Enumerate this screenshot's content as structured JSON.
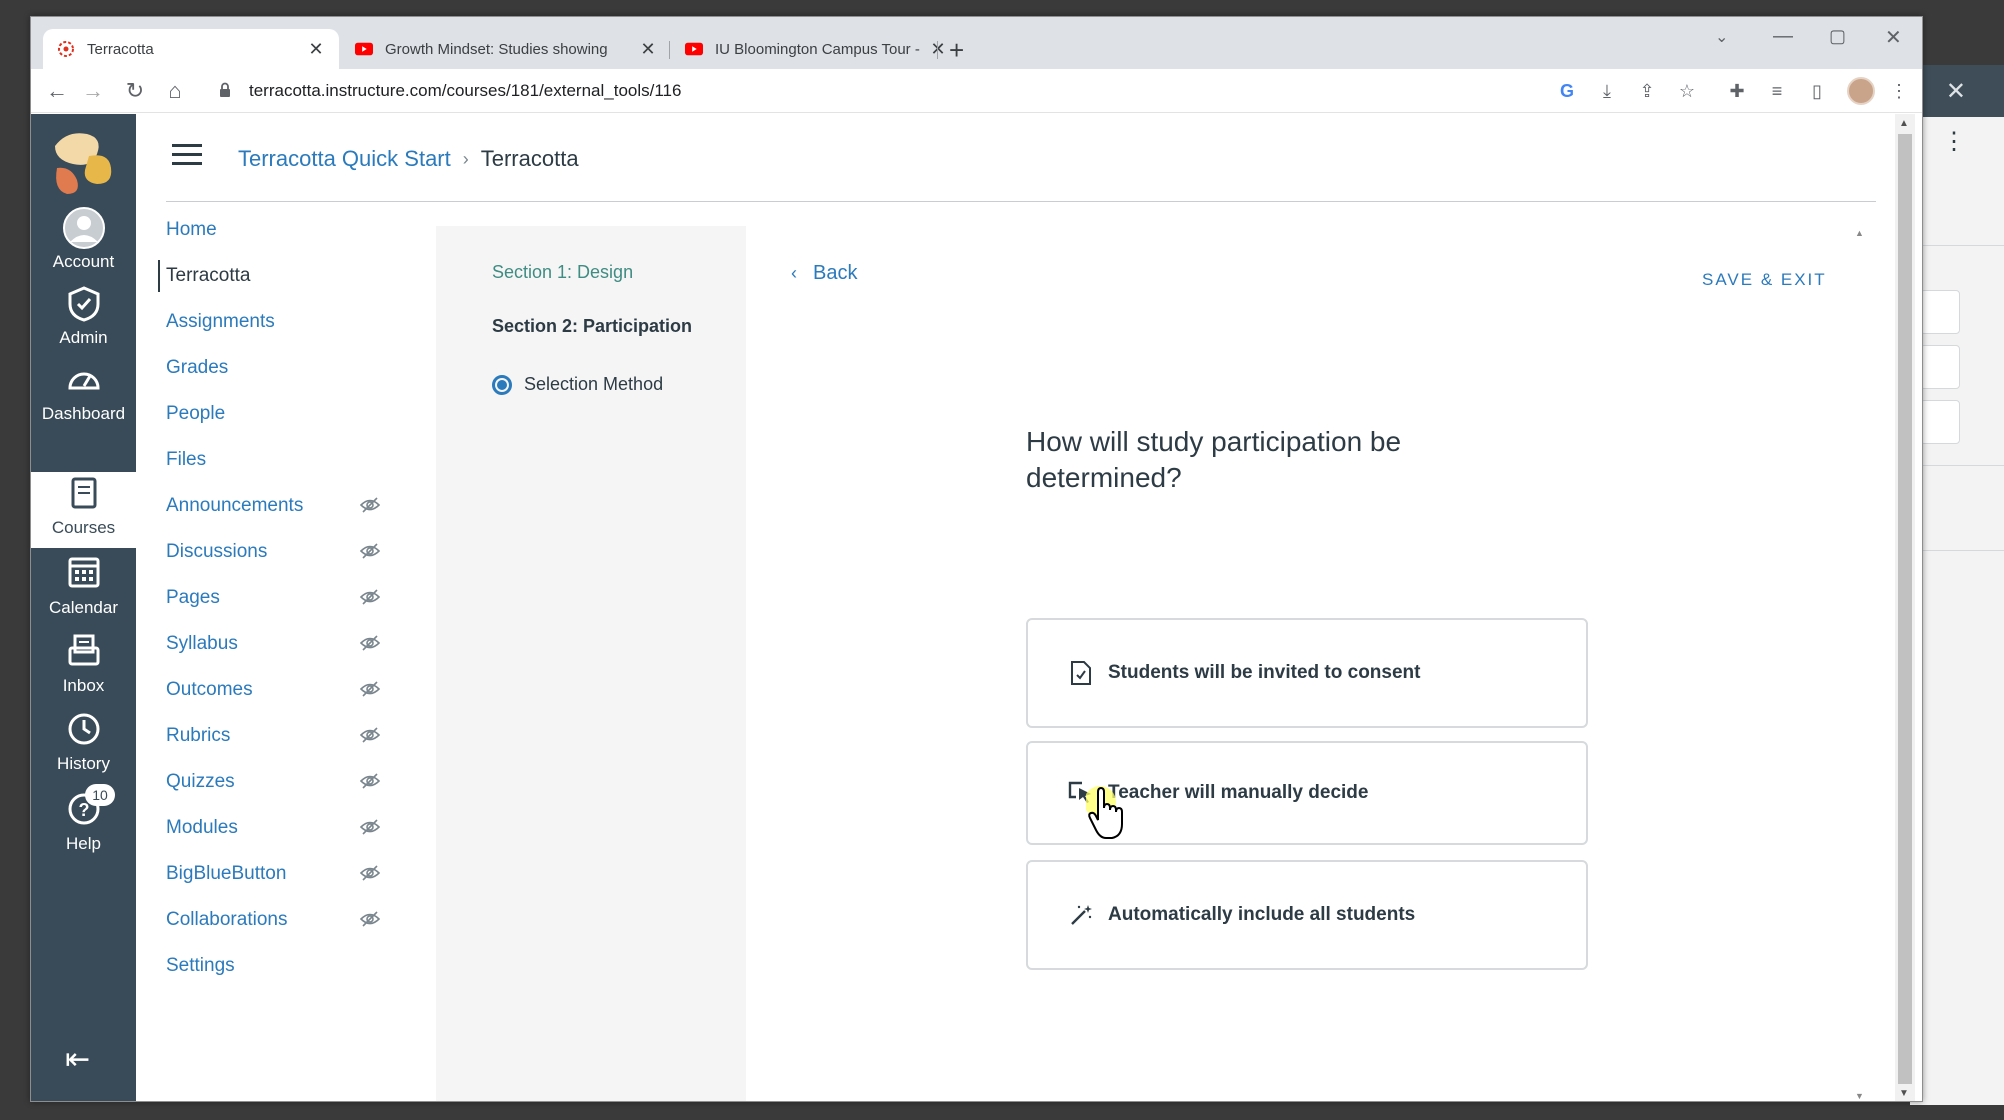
{
  "browser": {
    "tabs": [
      {
        "title": "Terracotta",
        "favicon": "canvas-logo-icon"
      },
      {
        "title": "Growth Mindset: Studies showing",
        "favicon": "youtube-icon"
      },
      {
        "title": "IU Bloomington Campus Tour - Y",
        "favicon": "youtube-icon"
      }
    ],
    "url": "terracotta.instructure.com/courses/181/external_tools/116",
    "notification_dot": "10"
  },
  "global_nav": {
    "items": [
      {
        "label": "Account",
        "icon": "avatar-icon"
      },
      {
        "label": "Admin",
        "icon": "shield-icon"
      },
      {
        "label": "Dashboard",
        "icon": "gauge-icon"
      },
      {
        "label": "Courses",
        "icon": "book-icon"
      },
      {
        "label": "Calendar",
        "icon": "calendar-icon"
      },
      {
        "label": "Inbox",
        "icon": "inbox-icon"
      },
      {
        "label": "History",
        "icon": "clock-icon"
      },
      {
        "label": "Help",
        "icon": "help-icon"
      }
    ],
    "help_badge": "10",
    "colors": {
      "nav_bg": "#394b58",
      "link": "#2b7abc",
      "teal": "#3f8c82"
    }
  },
  "breadcrumb": {
    "course": "Terracotta Quick Start",
    "current": "Terracotta"
  },
  "course_nav": [
    {
      "label": "Home",
      "hidden": false
    },
    {
      "label": "Terracotta",
      "hidden": false,
      "active": true
    },
    {
      "label": "Assignments",
      "hidden": false
    },
    {
      "label": "Grades",
      "hidden": false
    },
    {
      "label": "People",
      "hidden": false
    },
    {
      "label": "Files",
      "hidden": false
    },
    {
      "label": "Announcements",
      "hidden": true
    },
    {
      "label": "Discussions",
      "hidden": true
    },
    {
      "label": "Pages",
      "hidden": true
    },
    {
      "label": "Syllabus",
      "hidden": true
    },
    {
      "label": "Outcomes",
      "hidden": true
    },
    {
      "label": "Rubrics",
      "hidden": true
    },
    {
      "label": "Quizzes",
      "hidden": true
    },
    {
      "label": "Modules",
      "hidden": true
    },
    {
      "label": "BigBlueButton",
      "hidden": true
    },
    {
      "label": "Collaborations",
      "hidden": true
    },
    {
      "label": "Settings",
      "hidden": false
    }
  ],
  "steps": {
    "section1": "Section 1: Design",
    "section2": "Section 2: Participation",
    "current_step": "Selection Method"
  },
  "main": {
    "back_label": "Back",
    "save_exit_label": "SAVE & EXIT",
    "question": "How will study participation be determined?",
    "options": [
      {
        "label": "Students will be invited to consent",
        "icon": "document-check-icon"
      },
      {
        "label": "Teacher will manually decide",
        "icon": "cursor-select-icon"
      },
      {
        "label": "Automatically include all students",
        "icon": "magic-wand-icon"
      }
    ]
  }
}
